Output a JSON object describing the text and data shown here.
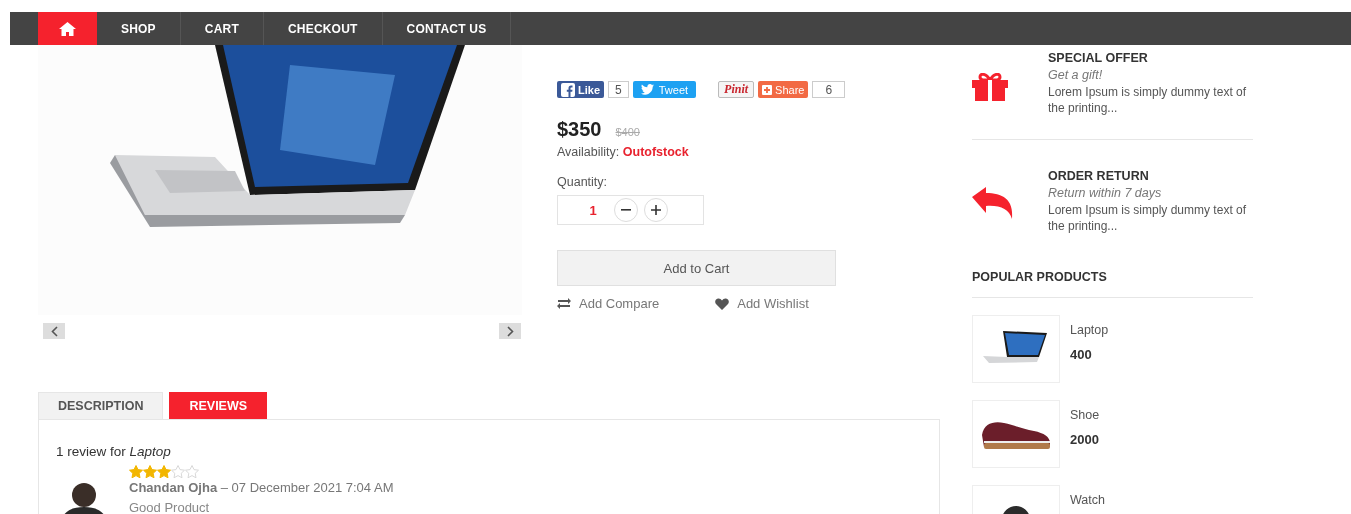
{
  "nav": {
    "items": [
      {
        "kind": "home",
        "selected": true
      },
      {
        "kind": "link",
        "label": "SHOP",
        "selected": false
      },
      {
        "kind": "link",
        "label": "CART",
        "selected": false
      },
      {
        "kind": "link",
        "label": "CHECKOUT",
        "selected": false
      },
      {
        "kind": "link",
        "label": "CONTACT US",
        "selected": false
      }
    ]
  },
  "social": [
    {
      "kind": "facebook",
      "label": "Like",
      "count": "5"
    },
    {
      "kind": "twitter",
      "label": "Tweet"
    },
    {
      "kind": "pinterest",
      "label": "Pinit"
    },
    {
      "kind": "share",
      "label": "Share",
      "count": "6"
    }
  ],
  "product": {
    "price": "$350",
    "old_price": "$400",
    "availability_label": "Availability:",
    "availability": "Outofstock",
    "quantity_label": "Quantity:",
    "quantity": "1",
    "add_to_cart": "Add to Cart",
    "actions": [
      {
        "kind": "compare",
        "label": "Add Compare"
      },
      {
        "kind": "wishlist",
        "label": "Add Wishlist"
      }
    ]
  },
  "features": [
    {
      "kind": "gift",
      "title": "SPECIAL OFFER",
      "subtitle": "Get a gift!",
      "text": "Lorem Ipsum is simply dummy text of the printing..."
    },
    {
      "kind": "return",
      "title": "ORDER RETURN",
      "subtitle": "Return within 7 days",
      "text": "Lorem Ipsum is simply dummy text of the printing..."
    }
  ],
  "popular": {
    "title": "POPULAR PRODUCTS",
    "items": [
      {
        "kind": "laptop",
        "name": "Laptop",
        "price": "400"
      },
      {
        "kind": "shoe",
        "name": "Shoe",
        "price": "2000"
      },
      {
        "kind": "watch",
        "name": "Watch"
      }
    ]
  },
  "tabs": [
    {
      "label": "DESCRIPTION",
      "selected": false
    },
    {
      "label": "REVIEWS",
      "selected": true
    }
  ],
  "reviews": {
    "heading": "1 review for *Laptop*",
    "items": [
      {
        "stars": 3,
        "author": "Chandan Ojha",
        "date": "– 07 December 2021 7:04 AM",
        "text": "Good Product"
      }
    ]
  }
}
